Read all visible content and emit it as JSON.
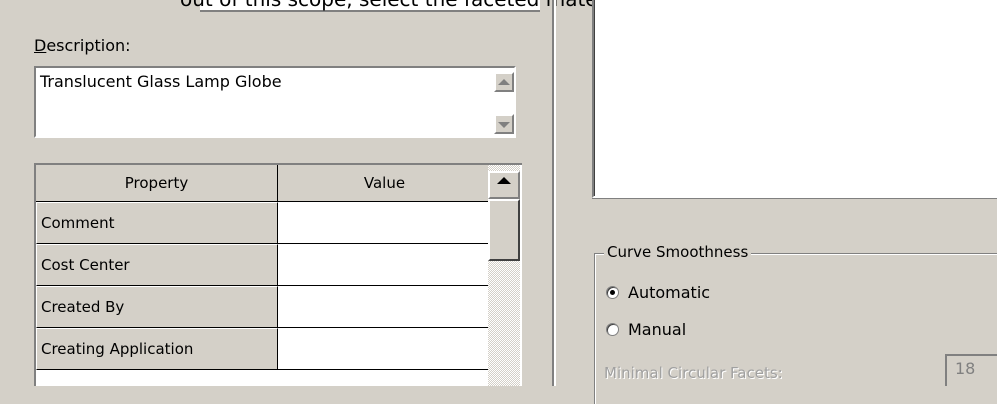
{
  "top_text": "out of this scope, select the faceted materials and",
  "description": {
    "label": "Description:",
    "label_access_key": "D",
    "label_rest": "escription:",
    "value": "Translucent Glass Lamp Globe"
  },
  "properties": {
    "columns": [
      "Property",
      "Value"
    ],
    "rows": [
      {
        "property": "Comment",
        "value": ""
      },
      {
        "property": "Cost Center",
        "value": ""
      },
      {
        "property": "Created By",
        "value": ""
      },
      {
        "property": "Creating Application",
        "value": ""
      }
    ]
  },
  "curve_smoothness": {
    "title": "Curve Smoothness",
    "options": [
      {
        "label": "Automatic",
        "checked": true
      },
      {
        "label": "Manual",
        "checked": false
      }
    ],
    "minimal_circular_facets_label": "Minimal Circular Facets:",
    "minimal_circular_facets_value": "18"
  },
  "icons": [
    "scroll-up-icon",
    "scroll-down-icon",
    "radio-checked-icon",
    "radio-unchecked-icon"
  ],
  "colors": {
    "face": "#d4d0c8",
    "shadow": "#808080",
    "highlight": "#ffffff",
    "disabled": "#a0a0a0"
  }
}
